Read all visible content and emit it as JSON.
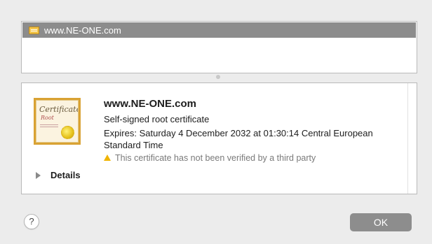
{
  "certificate_list": {
    "selected_item": "www.NE-ONE.com",
    "item_icon": "certificate-icon"
  },
  "details": {
    "icon": "certificate-large-icon",
    "icon_text_script": "Certificate",
    "icon_text_root": "Root",
    "title": "www.NE-ONE.com",
    "type": "Self-signed root certificate",
    "expires": "Expires: Saturday 4 December 2032 at 01:30:14 Central European Standard Time",
    "warning": "This certificate has not been verified by a third party",
    "warning_icon": "warning-triangle-icon",
    "warning_color": "#f0b400",
    "details_label": "Details"
  },
  "buttons": {
    "help": "?",
    "ok": "OK"
  }
}
